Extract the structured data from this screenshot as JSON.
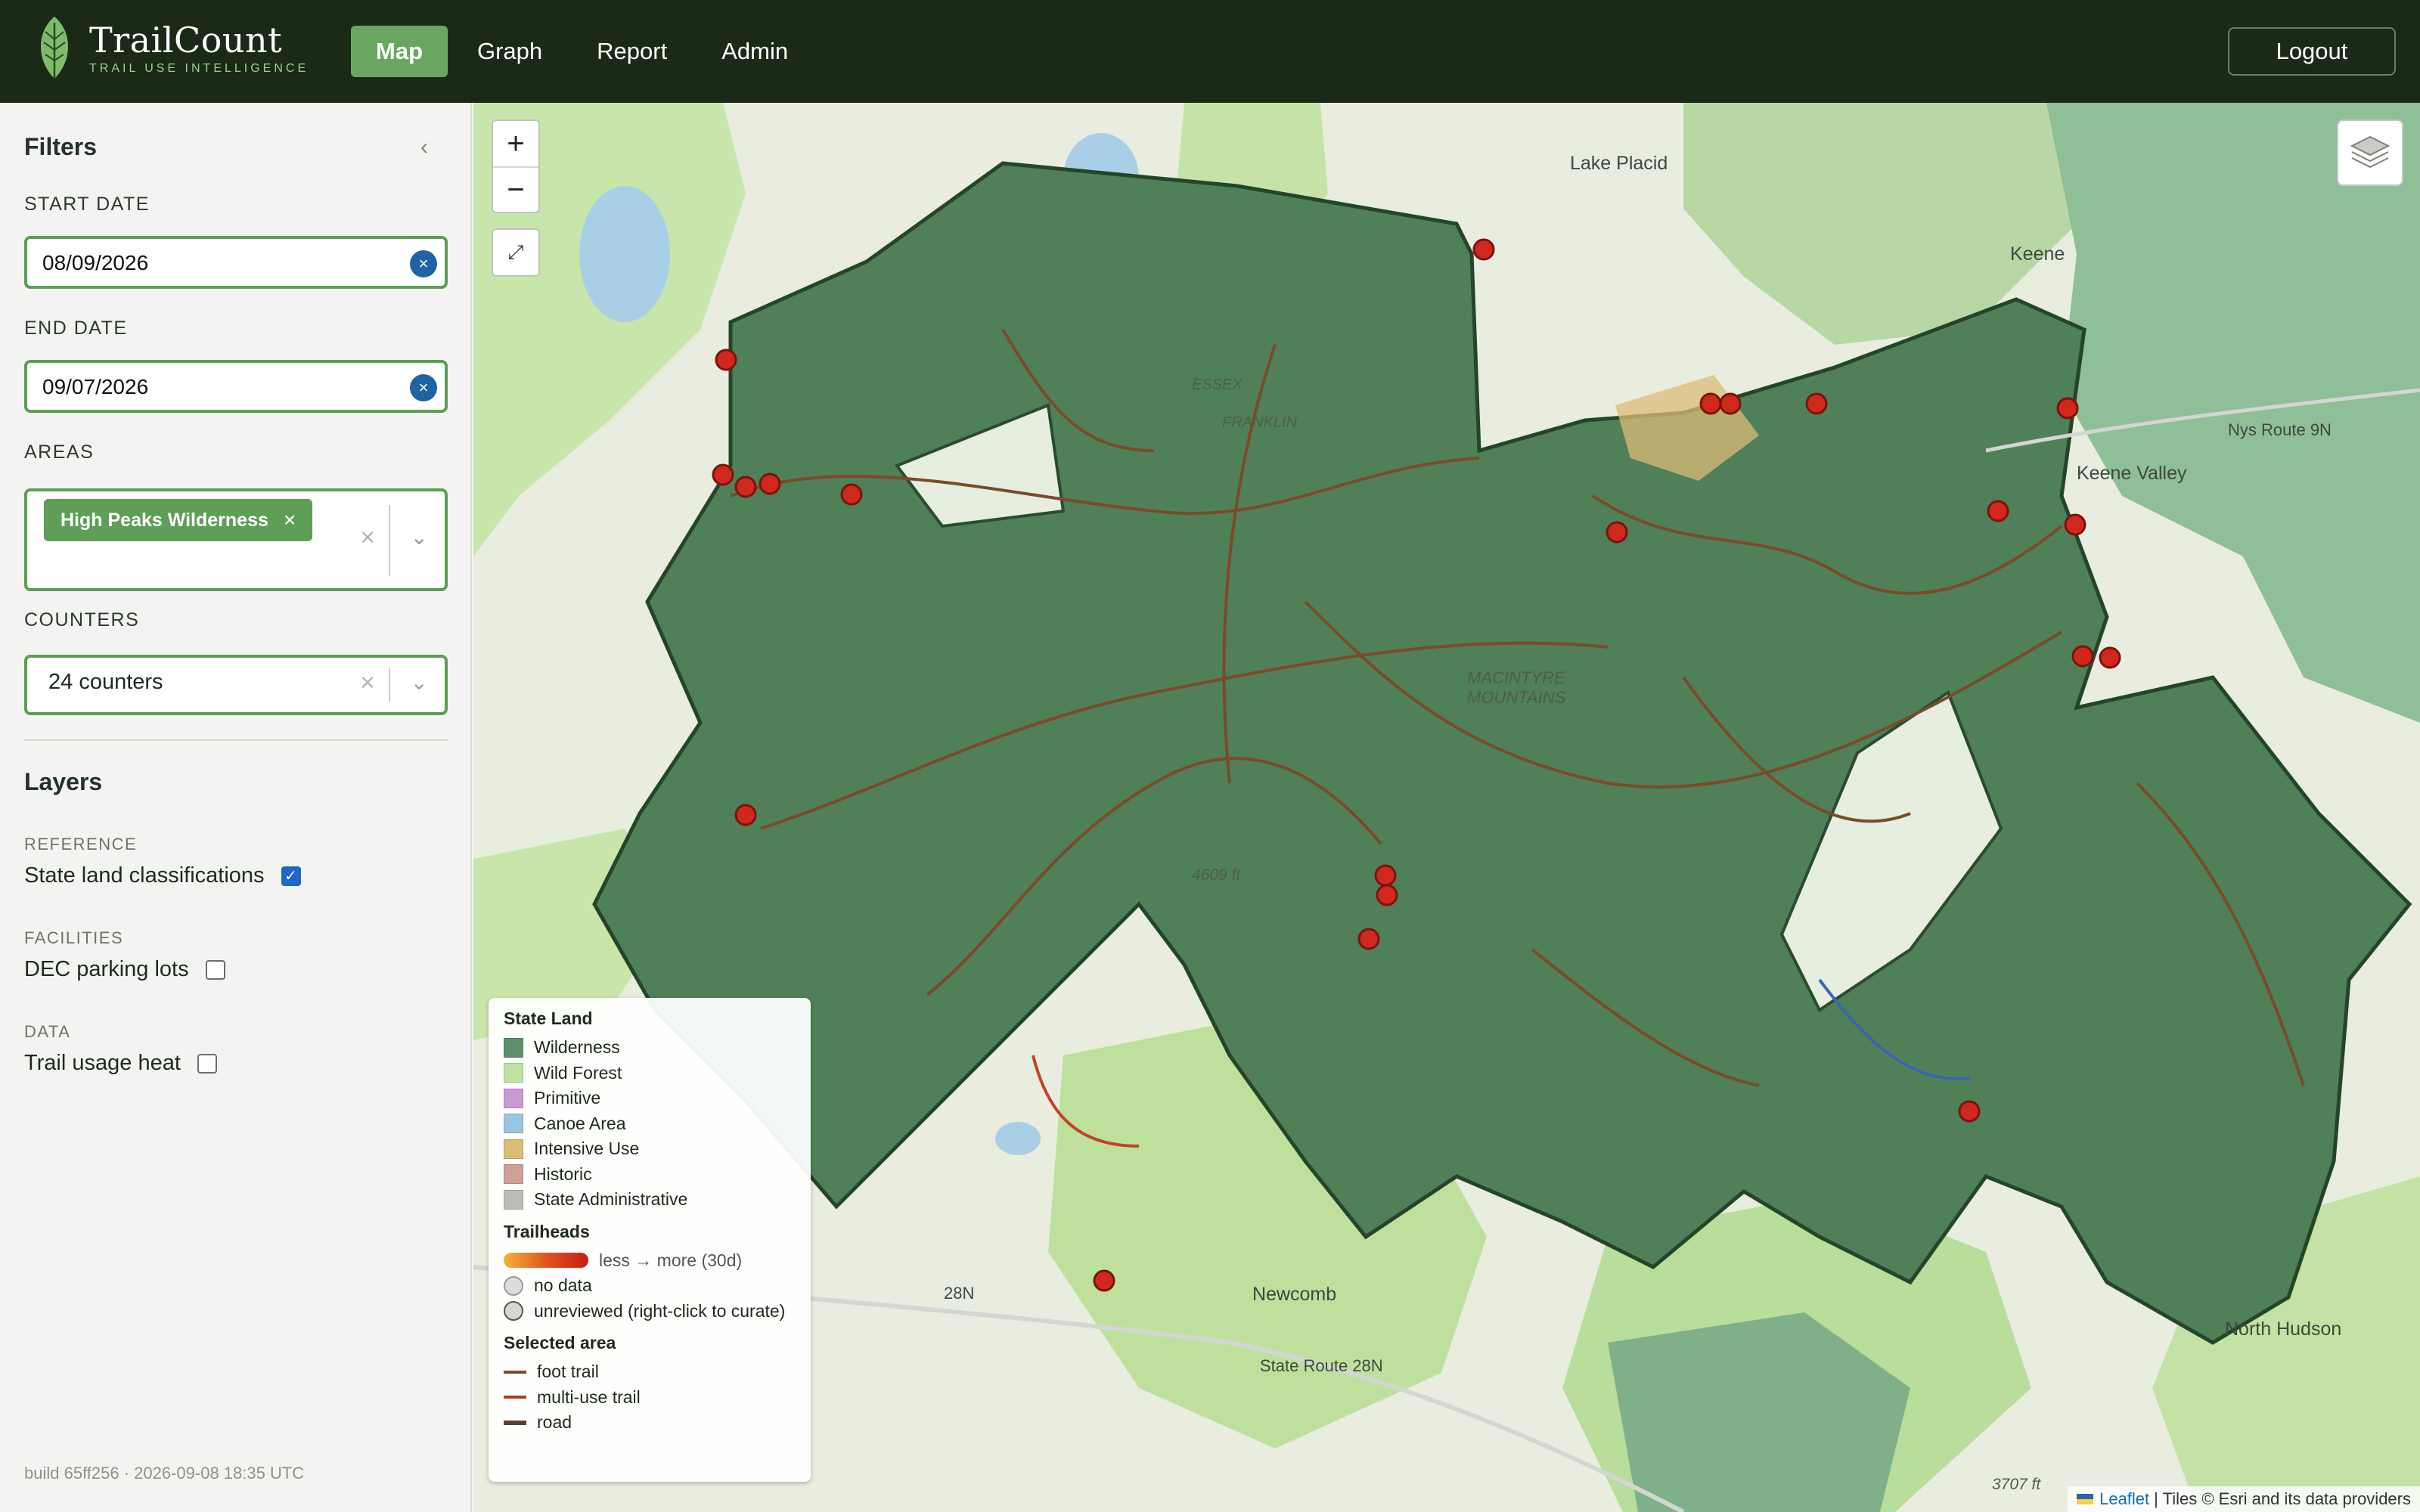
{
  "header": {
    "brand_name": "TrailCount",
    "brand_tagline": "TRAIL USE INTELLIGENCE",
    "tabs": [
      {
        "label": "Map",
        "active": true
      },
      {
        "label": "Graph",
        "active": false
      },
      {
        "label": "Report",
        "active": false
      },
      {
        "label": "Admin",
        "active": false
      }
    ],
    "logout_label": "Logout"
  },
  "sidebar": {
    "title": "Filters",
    "start_date_label": "START DATE",
    "start_date": "08/09/2026",
    "end_date_label": "END DATE",
    "end_date": "09/07/2026",
    "areas_label": "AREAS",
    "area_chip": "High Peaks Wilderness",
    "counters_label": "COUNTERS",
    "counters_value": "24 counters",
    "layers_title": "Layers",
    "groups": [
      {
        "label": "REFERENCE",
        "item": "State land classifications",
        "checked": true
      },
      {
        "label": "FACILITIES",
        "item": "DEC parking lots",
        "checked": false
      },
      {
        "label": "DATA",
        "item": "Trail usage heat",
        "checked": false
      }
    ],
    "build": "build 65ff256 · 2026-09-08 18:35 UTC"
  },
  "map": {
    "places": {
      "lake_placid": "Lake Placid",
      "keene": "Keene",
      "keene_valley": "Keene Valley",
      "newcomb": "Newcomb",
      "north_hudson": "North Hudson",
      "macintyre": "MACINTYRE MOUNTAINS",
      "essex": "ESSEX",
      "franklin": "FRANKLIN",
      "elev1": "4609 ft",
      "elev2": "3707 ft",
      "route_28n": "28N",
      "state_route": "State Route 28N",
      "nys_route": "Nys Route 9N"
    },
    "legend": {
      "state_land_title": "State Land",
      "classes": [
        {
          "label": "Wilderness",
          "color": "#5f8f6a"
        },
        {
          "label": "Wild Forest",
          "color": "#bfe3a1"
        },
        {
          "label": "Primitive",
          "color": "#c99ad6"
        },
        {
          "label": "Canoe Area",
          "color": "#9cc5df"
        },
        {
          "label": "Intensive Use",
          "color": "#dcbb78"
        },
        {
          "label": "Historic",
          "color": "#cfa094"
        },
        {
          "label": "State Administrative",
          "color": "#b8bdb6"
        }
      ],
      "trailheads_title": "Trailheads",
      "gradient_label": "less → more (30d)",
      "no_data_label": "no data",
      "unreviewed_label": "unreviewed (right-click to curate)",
      "selected_title": "Selected area",
      "trail_types": [
        {
          "label": "foot trail",
          "color": "#7a4a2a"
        },
        {
          "label": "multi-use trail",
          "color": "#a0441d"
        },
        {
          "label": "road",
          "color": "#5a4030"
        }
      ]
    },
    "attribution_leaflet": "Leaflet",
    "attribution_rest": "| Tiles © Esri and its data providers"
  }
}
